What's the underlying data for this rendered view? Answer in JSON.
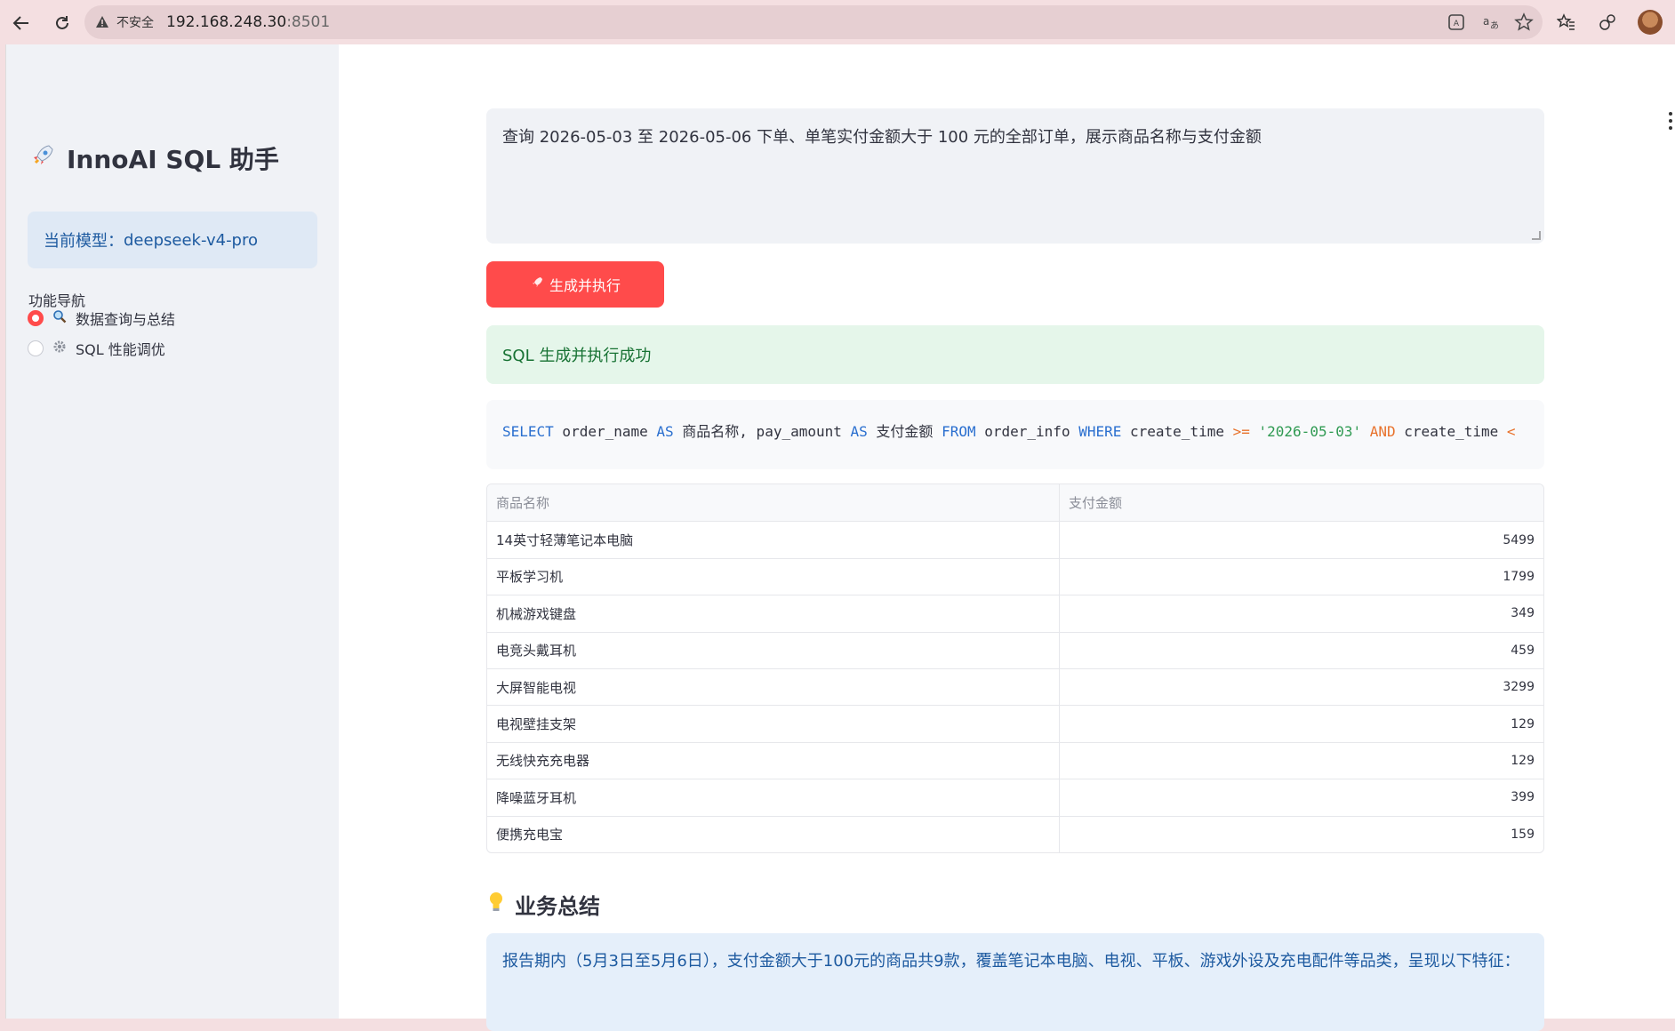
{
  "browser": {
    "insecure_label": "不安全",
    "url_host": "192.168.248.30",
    "url_port": ":8501"
  },
  "sidebar": {
    "title": "InnoAI SQL 助手",
    "title_icon": "rocket-icon",
    "model_label": "当前模型：",
    "model_value": "deepseek-v4-pro",
    "nav_label": "功能导航",
    "nav_items": [
      {
        "label": "数据查询与总结",
        "icon": "magnifier-icon",
        "selected": true
      },
      {
        "label": "SQL 性能调优",
        "icon": "gear-icon",
        "selected": false
      }
    ]
  },
  "main": {
    "query_text": "查询 2026-05-03 至 2026-05-06 下单、单笔实付金额大于 100 元的全部订单，展示商品名称与支付金额",
    "run_button_label": "生成并执行",
    "success_message": "SQL 生成并执行成功",
    "sql": {
      "t1": "SELECT",
      "t2": " order_name ",
      "t3": "AS",
      "t4": " 商品名称, pay_amount ",
      "t5": "AS",
      "t6": " 支付金额 ",
      "t7": "FROM",
      "t8": " order_info ",
      "t9": "WHERE",
      "t10": " create_time ",
      "t11": ">=",
      "t12": " ",
      "t13": "'2026-05-03'",
      "t14": " ",
      "t15": "AND",
      "t16": " create_time ",
      "t17": "<"
    },
    "table": {
      "columns": [
        "商品名称",
        "支付金额"
      ],
      "rows": [
        [
          "14英寸轻薄笔记本电脑",
          "5499"
        ],
        [
          "平板学习机",
          "1799"
        ],
        [
          "机械游戏键盘",
          "349"
        ],
        [
          "电竞头戴耳机",
          "459"
        ],
        [
          "大屏智能电视",
          "3299"
        ],
        [
          "电视壁挂支架",
          "129"
        ],
        [
          "无线快充充电器",
          "129"
        ],
        [
          "降噪蓝牙耳机",
          "399"
        ],
        [
          "便携充电宝",
          "159"
        ]
      ]
    },
    "summary_title": "业务总结",
    "summary_text": "报告期内（5月3日至5月6日），支付金额大于100元的商品共9款，覆盖笔记本电脑、电视、平板、游戏外设及充电配件等品类，呈现以下特征："
  },
  "colors": {
    "accent": "#ff4b4b",
    "sidebar_bg": "#f0f2f6",
    "success_bg": "#e5f6ea",
    "info_bg": "#e5effa"
  }
}
